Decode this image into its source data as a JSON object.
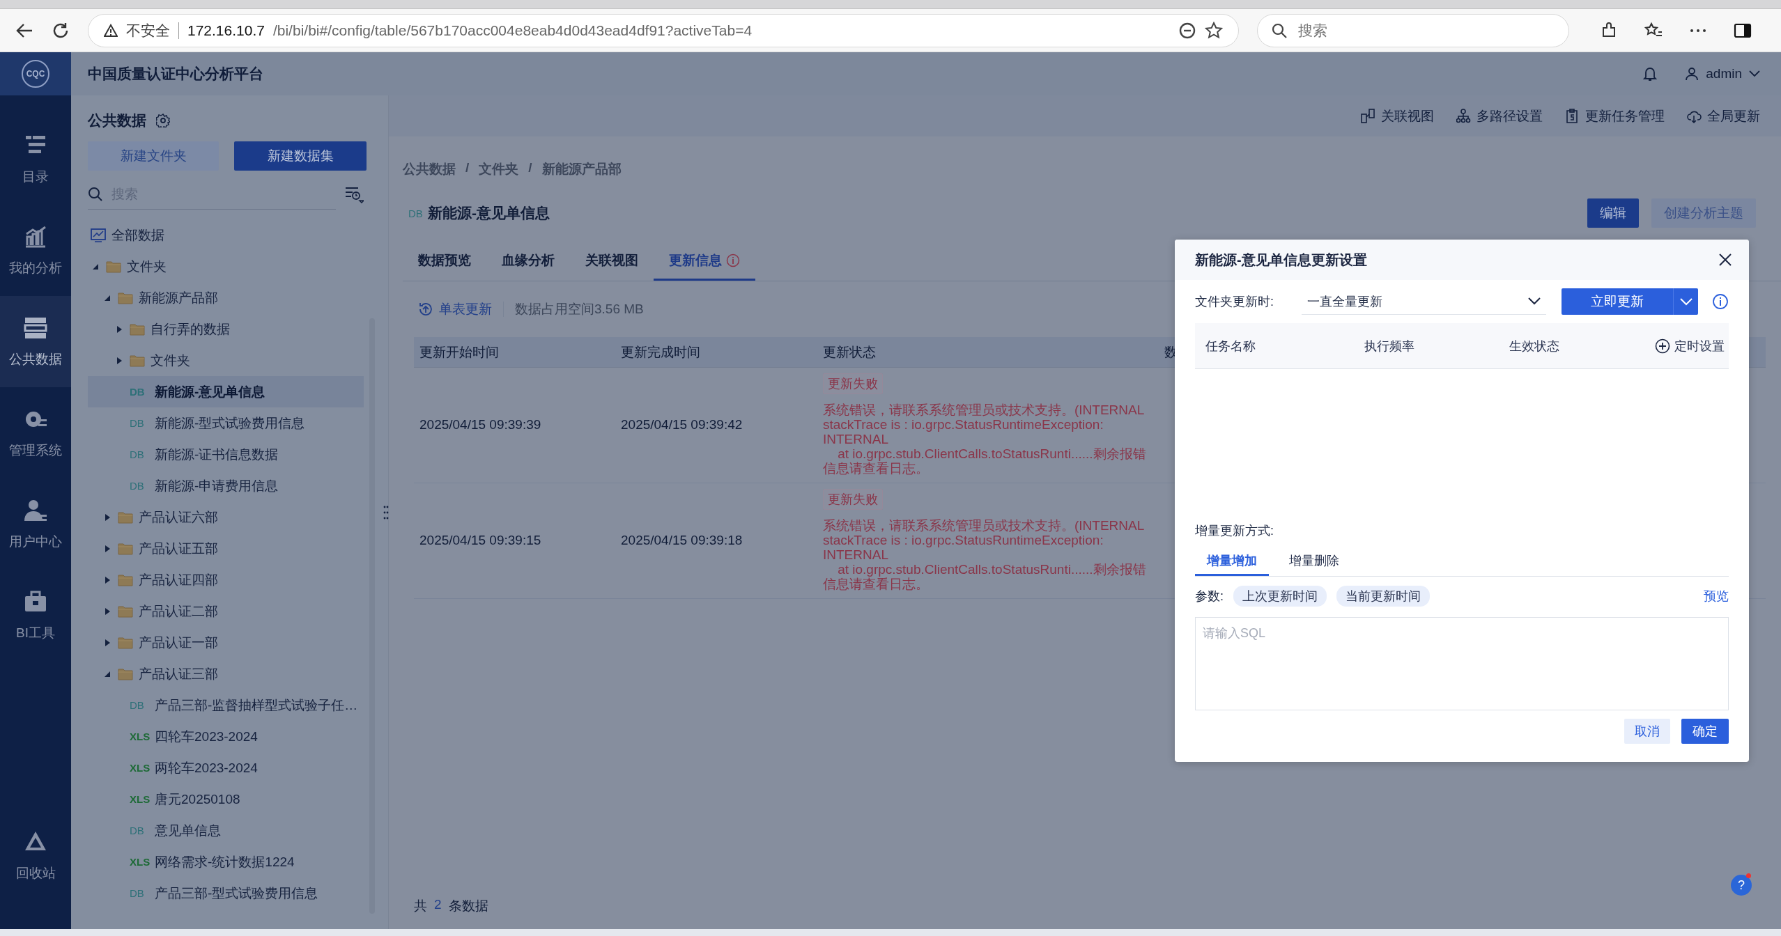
{
  "browser": {
    "security": "不安全",
    "url_host": "172.16.10.7",
    "url_path": "/bi/bi/bi#/config/table/567b170acc004e8eab4d0d43ead4df91?activeTab=4",
    "search_placeholder": "搜索"
  },
  "app": {
    "logo": "CQC",
    "title": "中国质量认证中心分析平台",
    "user": "admin"
  },
  "rail": {
    "items": [
      {
        "kind": "catalog",
        "label": "目录",
        "selected": false
      },
      {
        "kind": "analysis",
        "label": "我的分析",
        "selected": false
      },
      {
        "kind": "public",
        "label": "公共数据",
        "selected": true
      },
      {
        "kind": "admin",
        "label": "管理系统",
        "selected": false
      },
      {
        "kind": "user",
        "label": "用户中心",
        "selected": false
      },
      {
        "kind": "tools",
        "label": "BI工具",
        "selected": false
      }
    ],
    "footer": {
      "kind": "recycle",
      "label": "回收站",
      "selected": false
    }
  },
  "panel": {
    "title": "公共数据",
    "buttons": [
      {
        "label": "新建文件夹",
        "kind": "secondary"
      },
      {
        "label": "新建数据集",
        "kind": "primary"
      }
    ],
    "search_placeholder": "搜索",
    "tree": [
      {
        "kind": "root",
        "label": "全部数据",
        "selected": false
      },
      {
        "kind": "folder",
        "label": "文件夹",
        "expanded": true,
        "selected": false,
        "children": [
          {
            "kind": "folder",
            "label": "新能源产品部",
            "expanded": true,
            "selected": false,
            "children": [
              {
                "kind": "folder",
                "label": "自行弄的数据",
                "expanded": false,
                "selected": false
              },
              {
                "kind": "folder",
                "label": "文件夹",
                "expanded": false,
                "selected": false
              },
              {
                "kind": "db",
                "badge": "DB",
                "label": "新能源-意见单信息",
                "selected": true
              },
              {
                "kind": "db",
                "badge": "DB",
                "label": "新能源-型式试验费用信息",
                "selected": false
              },
              {
                "kind": "db",
                "badge": "DB",
                "label": "新能源-证书信息数据",
                "selected": false
              },
              {
                "kind": "db",
                "badge": "DB",
                "label": "新能源-申请费用信息",
                "selected": false
              }
            ]
          },
          {
            "kind": "folder",
            "label": "产品认证六部",
            "expanded": false,
            "selected": false
          },
          {
            "kind": "folder",
            "label": "产品认证五部",
            "expanded": false,
            "selected": false
          },
          {
            "kind": "folder",
            "label": "产品认证四部",
            "expanded": false,
            "selected": false
          },
          {
            "kind": "folder",
            "label": "产品认证二部",
            "expanded": false,
            "selected": false
          },
          {
            "kind": "folder",
            "label": "产品认证一部",
            "expanded": false,
            "selected": false
          },
          {
            "kind": "folder",
            "label": "产品认证三部",
            "expanded": true,
            "selected": false,
            "children": [
              {
                "kind": "db",
                "badge": "DB",
                "label": "产品三部-监督抽样型式试验子任…",
                "selected": false
              },
              {
                "kind": "xls",
                "badge": "XLS",
                "label": "四轮车2023-2024",
                "selected": false
              },
              {
                "kind": "xls",
                "badge": "XLS",
                "label": "两轮车2023-2024",
                "selected": false
              },
              {
                "kind": "xls",
                "badge": "XLS",
                "label": "唐元20250108",
                "selected": false
              },
              {
                "kind": "db",
                "badge": "DB",
                "label": "意见单信息",
                "selected": false
              },
              {
                "kind": "xls",
                "badge": "XLS",
                "label": "网络需求-统计数据1224",
                "selected": false
              },
              {
                "kind": "db",
                "badge": "DB",
                "label": "产品三部-型式试验费用信息",
                "selected": false
              }
            ]
          }
        ]
      }
    ]
  },
  "main": {
    "toolbar": [
      {
        "kind": "relation",
        "label": "关联视图"
      },
      {
        "kind": "paths",
        "label": "多路径设置"
      },
      {
        "kind": "tasks",
        "label": "更新任务管理"
      },
      {
        "kind": "cloud",
        "label": "全局更新"
      }
    ],
    "breadcrumb": [
      {
        "label": "公共数据"
      },
      {
        "separator": "/",
        "label": "文件夹"
      },
      {
        "separator": "/",
        "label": "新能源产品部"
      }
    ],
    "title": {
      "badge": "DB",
      "text": "新能源-意见单信息"
    },
    "actions": [
      {
        "label": "编辑",
        "kind": "primary"
      },
      {
        "label": "创建分析主题",
        "kind": "secondary"
      }
    ],
    "tabs": [
      {
        "label": "数据预览",
        "selected": false,
        "info": false
      },
      {
        "label": "血缘分析",
        "selected": false,
        "info": false
      },
      {
        "label": "关联视图",
        "selected": false,
        "info": false
      },
      {
        "label": "更新信息",
        "selected": true,
        "info": true
      }
    ],
    "update_link": "单表更新",
    "storage": "数据占用空间3.56 MB",
    "table": {
      "columns": [
        "更新开始时间",
        "更新完成时间",
        "更新状态",
        "数"
      ],
      "rows": [
        {
          "start": "2025/04/15 09:39:39",
          "end": "2025/04/15 09:39:42",
          "status": "更新失败",
          "message": "系统错误，请联系系统管理员或技术支持。(INTERNAL\nstackTrace is : io.grpc.StatusRuntimeException: INTERNAL\n\tat io.grpc.stub.ClientCalls.toStatusRunti......剩余报错信息请查看日志。"
        },
        {
          "start": "2025/04/15 09:39:15",
          "end": "2025/04/15 09:39:18",
          "status": "更新失败",
          "message": "系统错误，请联系系统管理员或技术支持。(INTERNAL\nstackTrace is : io.grpc.StatusRuntimeException: INTERNAL\n\tat io.grpc.stub.ClientCalls.toStatusRunti......剩余报错信息请查看日志。"
        }
      ]
    },
    "footer": {
      "prefix": "共",
      "count": "2",
      "suffix": "条数据"
    }
  },
  "dialog": {
    "title": "新能源-意见单信息更新设置",
    "folder_label": "文件夹更新时:",
    "folder_value": "一直全量更新",
    "update_button": "立即更新",
    "task_columns": [
      "任务名称",
      "执行频率",
      "生效状态"
    ],
    "schedule_link": "定时设置",
    "mode_label": "增量更新方式:",
    "mode_tabs": [
      {
        "label": "增量增加",
        "selected": true
      },
      {
        "label": "增量删除",
        "selected": false
      }
    ],
    "params_label": "参数:",
    "params": [
      "上次更新时间",
      "当前更新时间"
    ],
    "preview_link": "预览",
    "sql_placeholder": "请输入SQL",
    "cancel": "取消",
    "ok": "确定"
  },
  "help": "?"
}
